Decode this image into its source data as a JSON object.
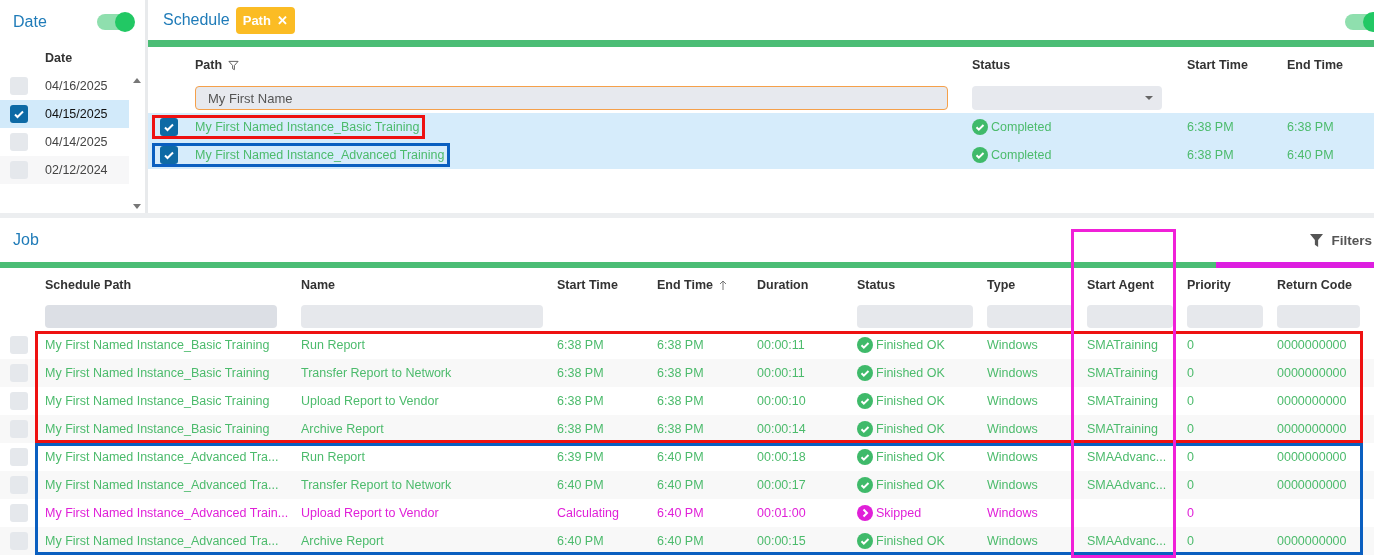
{
  "date_panel": {
    "title": "Date",
    "toggle_on": true,
    "column": "Date",
    "rows": [
      {
        "date": "04/16/2025",
        "selected": false
      },
      {
        "date": "04/15/2025",
        "selected": true
      },
      {
        "date": "04/14/2025",
        "selected": false
      },
      {
        "date": "02/12/2024",
        "selected": false
      }
    ]
  },
  "schedule": {
    "title": "Schedule",
    "chip": {
      "label": "Path",
      "close": "✕"
    },
    "toggle_on": true,
    "columns": [
      "Path",
      "Status",
      "Start Time",
      "End Time"
    ],
    "path_filter": {
      "value": "My First Name"
    },
    "rows": [
      {
        "checked": true,
        "path": "My First Named Instance_Basic Training",
        "status": "Completed",
        "start": "6:38 PM",
        "end": "6:38 PM",
        "color": "#ee1111"
      },
      {
        "checked": true,
        "path": "My First Named Instance_Advanced Training",
        "status": "Completed",
        "start": "6:38 PM",
        "end": "6:40 PM",
        "color": "#0a5fc0"
      }
    ]
  },
  "job": {
    "title": "Job",
    "filters_label": "Filters",
    "agent_highlight": {
      "color": "#f020d8"
    },
    "columns": [
      "Schedule Path",
      "Name",
      "Start Time",
      "End Time",
      "Duration",
      "Status",
      "Type",
      "Start Agent",
      "Priority",
      "Return Code"
    ],
    "groups": [
      {
        "color": "#ee1111",
        "rows": [
          {
            "checked": false,
            "color": "#4cbb6c",
            "kind": "ok",
            "path": "My First Named Instance_Basic Training",
            "name": "Run Report",
            "start": "6:38 PM",
            "end": "6:38 PM",
            "duration": "00:00:11",
            "status": "Finished OK",
            "type": "Windows",
            "agent": "SMATraining",
            "priority": "0",
            "return_code": "0000000000"
          },
          {
            "checked": false,
            "color": "#4cbb6c",
            "kind": "ok",
            "path": "My First Named Instance_Basic Training",
            "name": "Transfer Report to Network",
            "start": "6:38 PM",
            "end": "6:38 PM",
            "duration": "00:00:11",
            "status": "Finished OK",
            "type": "Windows",
            "agent": "SMATraining",
            "priority": "0",
            "return_code": "0000000000"
          },
          {
            "checked": false,
            "color": "#4cbb6c",
            "kind": "ok",
            "path": "My First Named Instance_Basic Training",
            "name": "Upload Report to Vendor",
            "start": "6:38 PM",
            "end": "6:38 PM",
            "duration": "00:00:10",
            "status": "Finished OK",
            "type": "Windows",
            "agent": "SMATraining",
            "priority": "0",
            "return_code": "0000000000"
          },
          {
            "checked": false,
            "color": "#4cbb6c",
            "kind": "ok",
            "path": "My First Named Instance_Basic Training",
            "name": "Archive Report",
            "start": "6:38 PM",
            "end": "6:38 PM",
            "duration": "00:00:14",
            "status": "Finished OK",
            "type": "Windows",
            "agent": "SMATraining",
            "priority": "0",
            "return_code": "0000000000"
          }
        ]
      },
      {
        "color": "#0a5fc0",
        "rows": [
          {
            "checked": false,
            "color": "#4cbb6c",
            "kind": "ok",
            "path": "My First Named Instance_Advanced Tra...",
            "name": "Run Report",
            "start": "6:39 PM",
            "end": "6:40 PM",
            "duration": "00:00:18",
            "status": "Finished OK",
            "type": "Windows",
            "agent": "SMAAdvanc...",
            "priority": "0",
            "return_code": "0000000000"
          },
          {
            "checked": false,
            "color": "#4cbb6c",
            "kind": "ok",
            "path": "My First Named Instance_Advanced Tra...",
            "name": "Transfer Report to Network",
            "start": "6:40 PM",
            "end": "6:40 PM",
            "duration": "00:00:17",
            "status": "Finished OK",
            "type": "Windows",
            "agent": "SMAAdvanc...",
            "priority": "0",
            "return_code": "0000000000"
          },
          {
            "checked": false,
            "color": "#e020d8",
            "kind": "skipped",
            "path": "My First Named Instance_Advanced Train...",
            "name": "Upload Report to Vendor",
            "start": "Calculating",
            "end": "6:40 PM",
            "duration": "00:01:00",
            "status": "Skipped",
            "type": "Windows",
            "priority": "0"
          },
          {
            "checked": false,
            "color": "#4cbb6c",
            "kind": "ok",
            "path": "My First Named Instance_Advanced Tra...",
            "name": "Archive Report",
            "start": "6:40 PM",
            "end": "6:40 PM",
            "duration": "00:00:15",
            "status": "Finished OK",
            "type": "Windows",
            "agent": "SMAAdvanc...",
            "priority": "0",
            "return_code": "0000000000"
          }
        ]
      }
    ]
  }
}
